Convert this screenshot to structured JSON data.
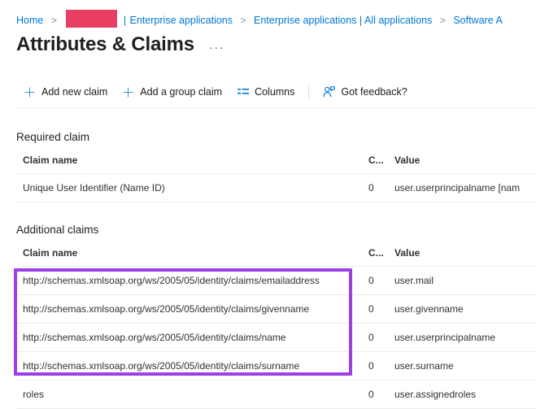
{
  "breadcrumb": {
    "home": "Home",
    "separator": ">",
    "redacted_tenant": "",
    "pipe": "|",
    "item2": "Enterprise applications",
    "item3": "Enterprise applications | All applications",
    "item4": "Software A"
  },
  "page": {
    "title": "Attributes & Claims",
    "more_options": "···"
  },
  "toolbar": {
    "add_new_claim": "Add new claim",
    "add_group_claim": "Add a group claim",
    "columns": "Columns",
    "got_feedback": "Got feedback?",
    "icons": {
      "add": "plus-icon",
      "columns": "columns-icon",
      "feedback": "feedback-person-icon"
    }
  },
  "required_claim": {
    "heading": "Required claim",
    "columns": [
      "Claim name",
      "C...",
      "Value"
    ],
    "rows": [
      {
        "name": "Unique User Identifier (Name ID)",
        "count": "0",
        "value": "user.userprincipalname [nam"
      }
    ]
  },
  "additional_claims": {
    "heading": "Additional claims",
    "columns": [
      "Claim name",
      "C...",
      "Value"
    ],
    "rows": [
      {
        "name": "http://schemas.xmlsoap.org/ws/2005/05/identity/claims/emailaddress",
        "count": "0",
        "value": "user.mail",
        "highlighted": true
      },
      {
        "name": "http://schemas.xmlsoap.org/ws/2005/05/identity/claims/givenname",
        "count": "0",
        "value": "user.givenname",
        "highlighted": true
      },
      {
        "name": "http://schemas.xmlsoap.org/ws/2005/05/identity/claims/name",
        "count": "0",
        "value": "user.userprincipalname",
        "highlighted": true
      },
      {
        "name": "http://schemas.xmlsoap.org/ws/2005/05/identity/claims/surname",
        "count": "0",
        "value": "user.surname",
        "highlighted": true
      },
      {
        "name": "roles",
        "count": "0",
        "value": "user.assignedroles",
        "highlighted": false
      }
    ]
  },
  "colors": {
    "link": "#0078d4",
    "highlight_border": "#9b3fe8",
    "redaction": "#e83e62",
    "text": "#323130"
  }
}
